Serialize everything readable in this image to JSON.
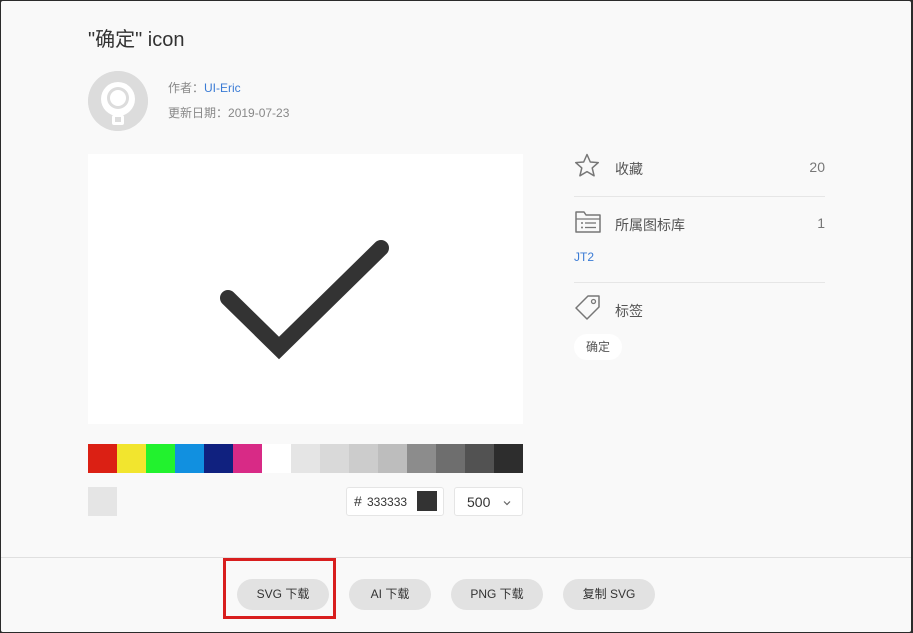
{
  "header": {
    "title": "\"确定\" icon"
  },
  "author": {
    "label": "作者：",
    "name": "UI-Eric",
    "updated_label": "更新日期：",
    "updated_date": "2019-07-23"
  },
  "palette": {
    "colors": [
      "#db2014",
      "#f2e52e",
      "#22f22e",
      "#1190e0",
      "#10217f",
      "#d82a86",
      "#ffffff",
      "#e5e5e5",
      "#d9d9d9",
      "#cccccc",
      "#bdbdbd",
      "#8c8c8c",
      "#6e6e6e",
      "#525252",
      "#2d2d2d"
    ]
  },
  "color_picker": {
    "hash": "#",
    "hex": "333333",
    "current_color": "#333333"
  },
  "size_select": {
    "value": "500",
    "chevron": "chevron-down-icon"
  },
  "sidebar": {
    "favorite": {
      "label": "收藏",
      "count": "20",
      "icon": "star-icon"
    },
    "library": {
      "label": "所属图标库",
      "count": "1",
      "icon": "folder-list-icon",
      "link": "JT2"
    },
    "tags": {
      "label": "标签",
      "icon": "tag-icon",
      "items": [
        "确定"
      ]
    }
  },
  "footer": {
    "buttons": [
      "SVG 下载",
      "AI 下载",
      "PNG 下载",
      "复制 SVG"
    ]
  },
  "colors": {
    "accent_link": "#3a7bd5",
    "highlight": "#d81e1e",
    "icon": "#333333"
  }
}
